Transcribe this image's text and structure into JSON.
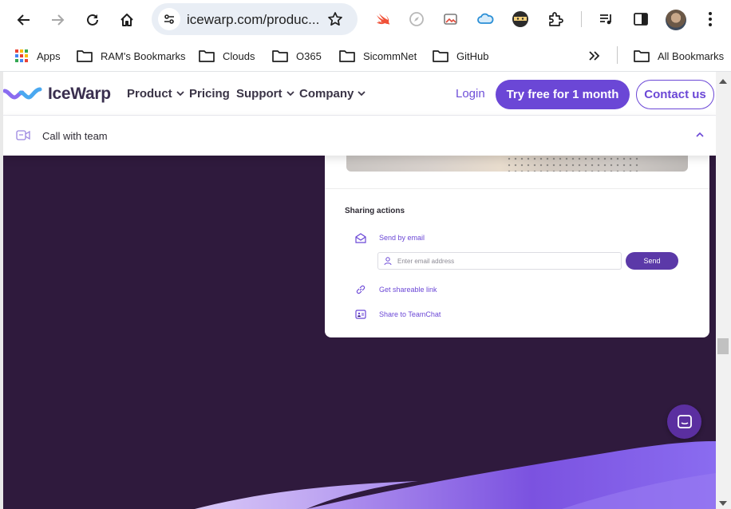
{
  "browser": {
    "url": "icewarp.com/produc...",
    "bookmarks": [
      {
        "label": "Apps",
        "icon": "apps-grid-icon"
      },
      {
        "label": "RAM's Bookmarks",
        "icon": "folder-icon"
      },
      {
        "label": "Clouds",
        "icon": "folder-icon"
      },
      {
        "label": "O365",
        "icon": "folder-icon"
      },
      {
        "label": "SicommNet",
        "icon": "folder-icon"
      },
      {
        "label": "GitHub",
        "icon": "folder-icon"
      }
    ],
    "all_bookmarks": "All Bookmarks"
  },
  "site": {
    "brand": "IceWarp",
    "nav": [
      {
        "label": "Product"
      },
      {
        "label": "Pricing"
      },
      {
        "label": "Support"
      },
      {
        "label": "Company"
      }
    ],
    "login": "Login",
    "cta_primary": "Try free for 1 month",
    "cta_secondary": "Contact us",
    "brand_color": "#6b47d6"
  },
  "subbar": {
    "title": "Call with team"
  },
  "sharing": {
    "title": "Sharing actions",
    "send_by_email": "Send by email",
    "email_placeholder": "Enter email address",
    "send": "Send",
    "shareable_link": "Get shareable link",
    "teamchat": "Share to TeamChat"
  }
}
